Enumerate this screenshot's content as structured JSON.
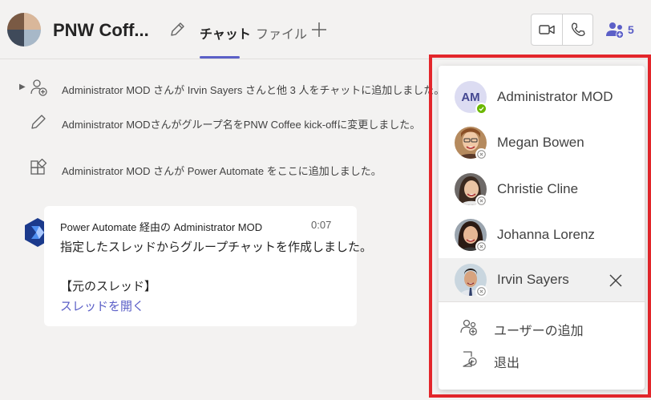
{
  "header": {
    "chat_title": "PNW Coff...",
    "tabs": [
      {
        "label": "チャット",
        "active": true
      },
      {
        "label": "ファイル",
        "active": false
      }
    ],
    "participants_count": "5",
    "accent_color": "#5b5fc7"
  },
  "system_messages": [
    {
      "icon": "add-person-icon",
      "text": "Administrator MOD さんが Irvin Sayers さんと他 3 人をチャットに追加しました。"
    },
    {
      "icon": "pencil-icon",
      "text": "Administrator MODさんがグループ名をPNW Coffee kick-offに変更しました。"
    },
    {
      "icon": "apps-icon",
      "text": "Administrator MOD さんが Power Automate をここに追加しました。"
    }
  ],
  "message": {
    "sender": "Power Automate 経由の Administrator MOD",
    "time": "0:07",
    "line1": "指定したスレッドからグループチャットを作成しました。",
    "line2": "【元のスレッド】",
    "link": "スレッドを開く"
  },
  "participants": {
    "people": [
      {
        "name": "Administrator MOD",
        "initials": "AM",
        "status": "available"
      },
      {
        "name": "Megan Bowen",
        "status": "offline"
      },
      {
        "name": "Christie Cline",
        "status": "offline"
      },
      {
        "name": "Johanna Lorenz",
        "status": "offline"
      },
      {
        "name": "Irvin Sayers",
        "status": "offline",
        "selected": true
      }
    ],
    "actions": [
      {
        "label": "ユーザーの追加",
        "icon": "add-user-icon"
      },
      {
        "label": "退出",
        "icon": "leave-icon"
      }
    ]
  }
}
